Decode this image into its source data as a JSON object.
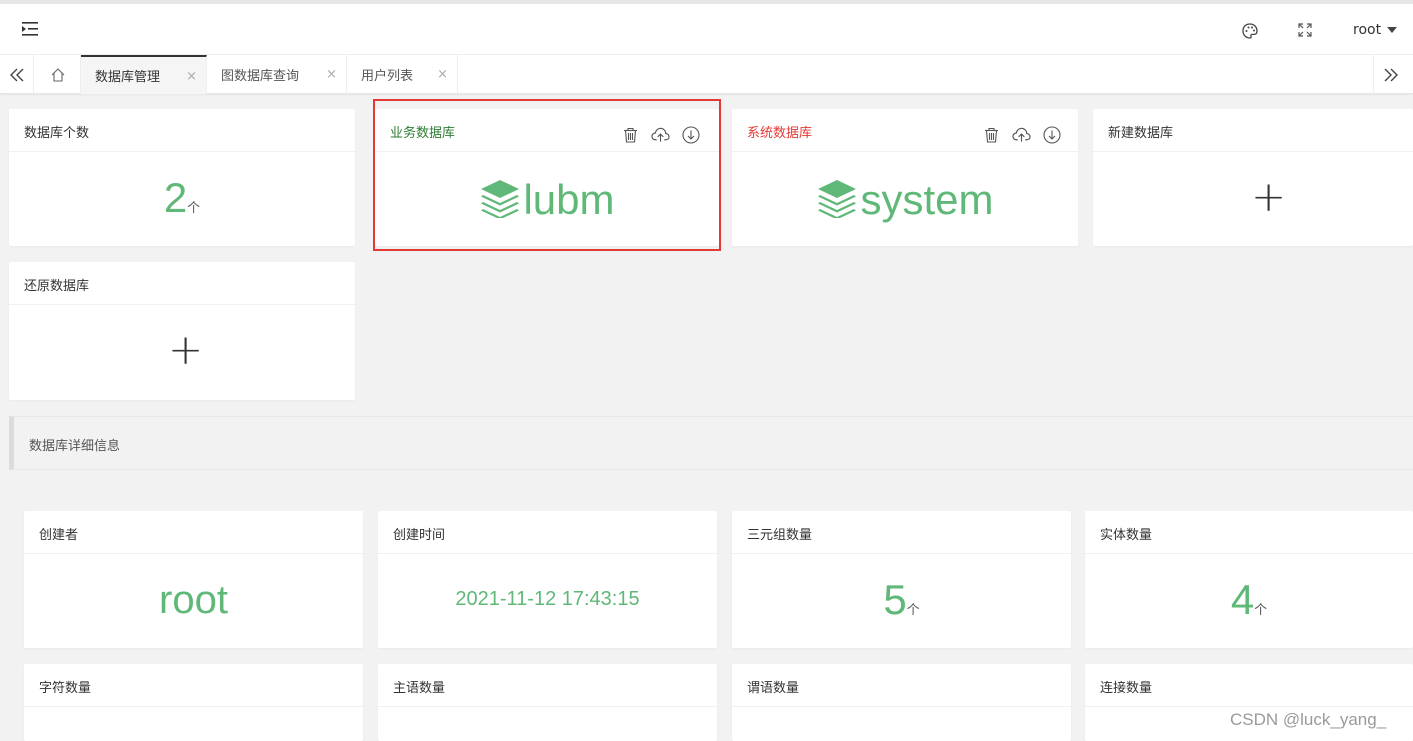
{
  "header": {
    "menu_icon": "menu-fold-icon",
    "palette_icon": "palette-icon",
    "fullscreen_icon": "fullscreen-icon",
    "user": "root"
  },
  "tabs": {
    "prev_icon": "double-chevron-left-icon",
    "next_icon": "double-chevron-right-icon",
    "home_icon": "home-icon",
    "items": [
      {
        "label": "数据库管理",
        "close": "×",
        "active": true
      },
      {
        "label": "图数据库查询",
        "close": "×",
        "active": false
      },
      {
        "label": "用户列表",
        "close": "×",
        "active": false
      }
    ]
  },
  "summary": {
    "count_title": "数据库个数",
    "count_value": "2",
    "count_unit": "个",
    "new_db_title": "新建数据库",
    "restore_db_title": "还原数据库",
    "plus": "+"
  },
  "databases": [
    {
      "title": "业务数据库",
      "name": "lubm",
      "title_color": "#2e7d32",
      "selected": true
    },
    {
      "title": "系统数据库",
      "name": "system",
      "title_color": "#e53935",
      "selected": false
    }
  ],
  "detail": {
    "section_title": "数据库详细信息",
    "stats": [
      {
        "label": "创建者",
        "value": "root",
        "unit": ""
      },
      {
        "label": "创建时间",
        "value": "2021-11-12 17:43:15",
        "unit": ""
      },
      {
        "label": "三元组数量",
        "value": "5",
        "unit": "个"
      },
      {
        "label": "实体数量",
        "value": "4",
        "unit": "个"
      },
      {
        "label": "字符数量",
        "value": "",
        "unit": ""
      },
      {
        "label": "主语数量",
        "value": "",
        "unit": ""
      },
      {
        "label": "谓语数量",
        "value": "",
        "unit": ""
      },
      {
        "label": "连接数量",
        "value": "",
        "unit": ""
      }
    ]
  },
  "colors": {
    "accent_green": "#5fb878",
    "danger_red": "#e53935",
    "title_green": "#2e7d32"
  },
  "watermark": "CSDN @luck_yang_"
}
